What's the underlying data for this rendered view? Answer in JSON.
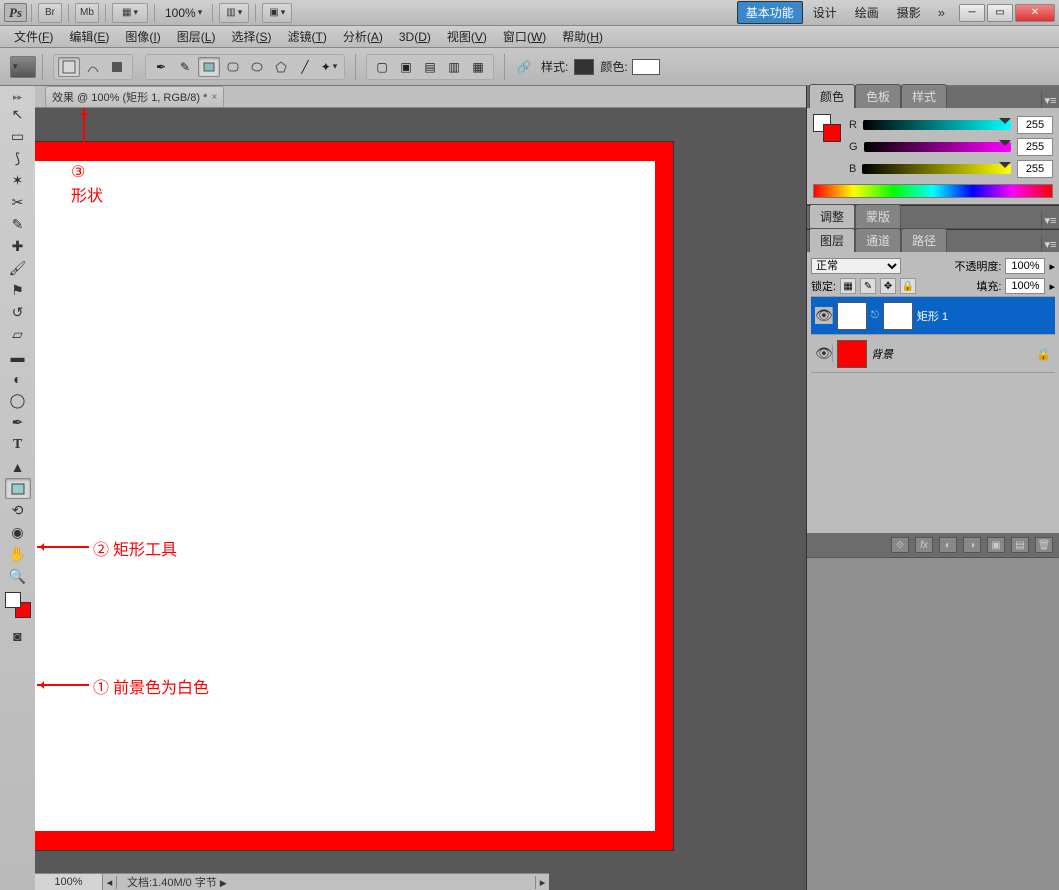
{
  "titlebar": {
    "zoom": "100%",
    "workspaces": [
      "基本功能",
      "设计",
      "绘画",
      "摄影"
    ],
    "active_workspace": 0
  },
  "menus": [
    {
      "label": "文件",
      "key": "F"
    },
    {
      "label": "编辑",
      "key": "E"
    },
    {
      "label": "图像",
      "key": "I"
    },
    {
      "label": "图层",
      "key": "L"
    },
    {
      "label": "选择",
      "key": "S"
    },
    {
      "label": "滤镜",
      "key": "T"
    },
    {
      "label": "分析",
      "key": "A"
    },
    {
      "label": "3D",
      "key": "D"
    },
    {
      "label": "视图",
      "key": "V"
    },
    {
      "label": "窗口",
      "key": "W"
    },
    {
      "label": "帮助",
      "key": "H"
    }
  ],
  "options": {
    "style_label": "样式:",
    "color_label": "颜色:"
  },
  "doc": {
    "tab_title": "效果 @ 100% (矩形 1, RGB/8) *",
    "zoom_status": "100%",
    "doc_info": "文档:1.40M/0 字节"
  },
  "annotations": {
    "a1": "① 前景色为白色",
    "a2": "② 矩形工具",
    "a3": "③",
    "a3b": "形状"
  },
  "color_panel": {
    "tabs": [
      "颜色",
      "色板",
      "样式"
    ],
    "r": {
      "label": "R",
      "value": "255"
    },
    "g": {
      "label": "G",
      "value": "255"
    },
    "b": {
      "label": "B",
      "value": "255"
    }
  },
  "adjust_panel": {
    "tabs": [
      "调整",
      "蒙版"
    ]
  },
  "layers_panel": {
    "tabs": [
      "图层",
      "通道",
      "路径"
    ],
    "blend_mode": "正常",
    "opacity_label": "不透明度:",
    "opacity_value": "100%",
    "lock_label": "锁定:",
    "fill_label": "填充:",
    "fill_value": "100%",
    "layers": [
      {
        "name": "矩形 1",
        "selected": true,
        "thumb": "#fff",
        "mask": "#fff"
      },
      {
        "name": "背景",
        "selected": false,
        "thumb": "#f00",
        "locked": true
      }
    ]
  }
}
